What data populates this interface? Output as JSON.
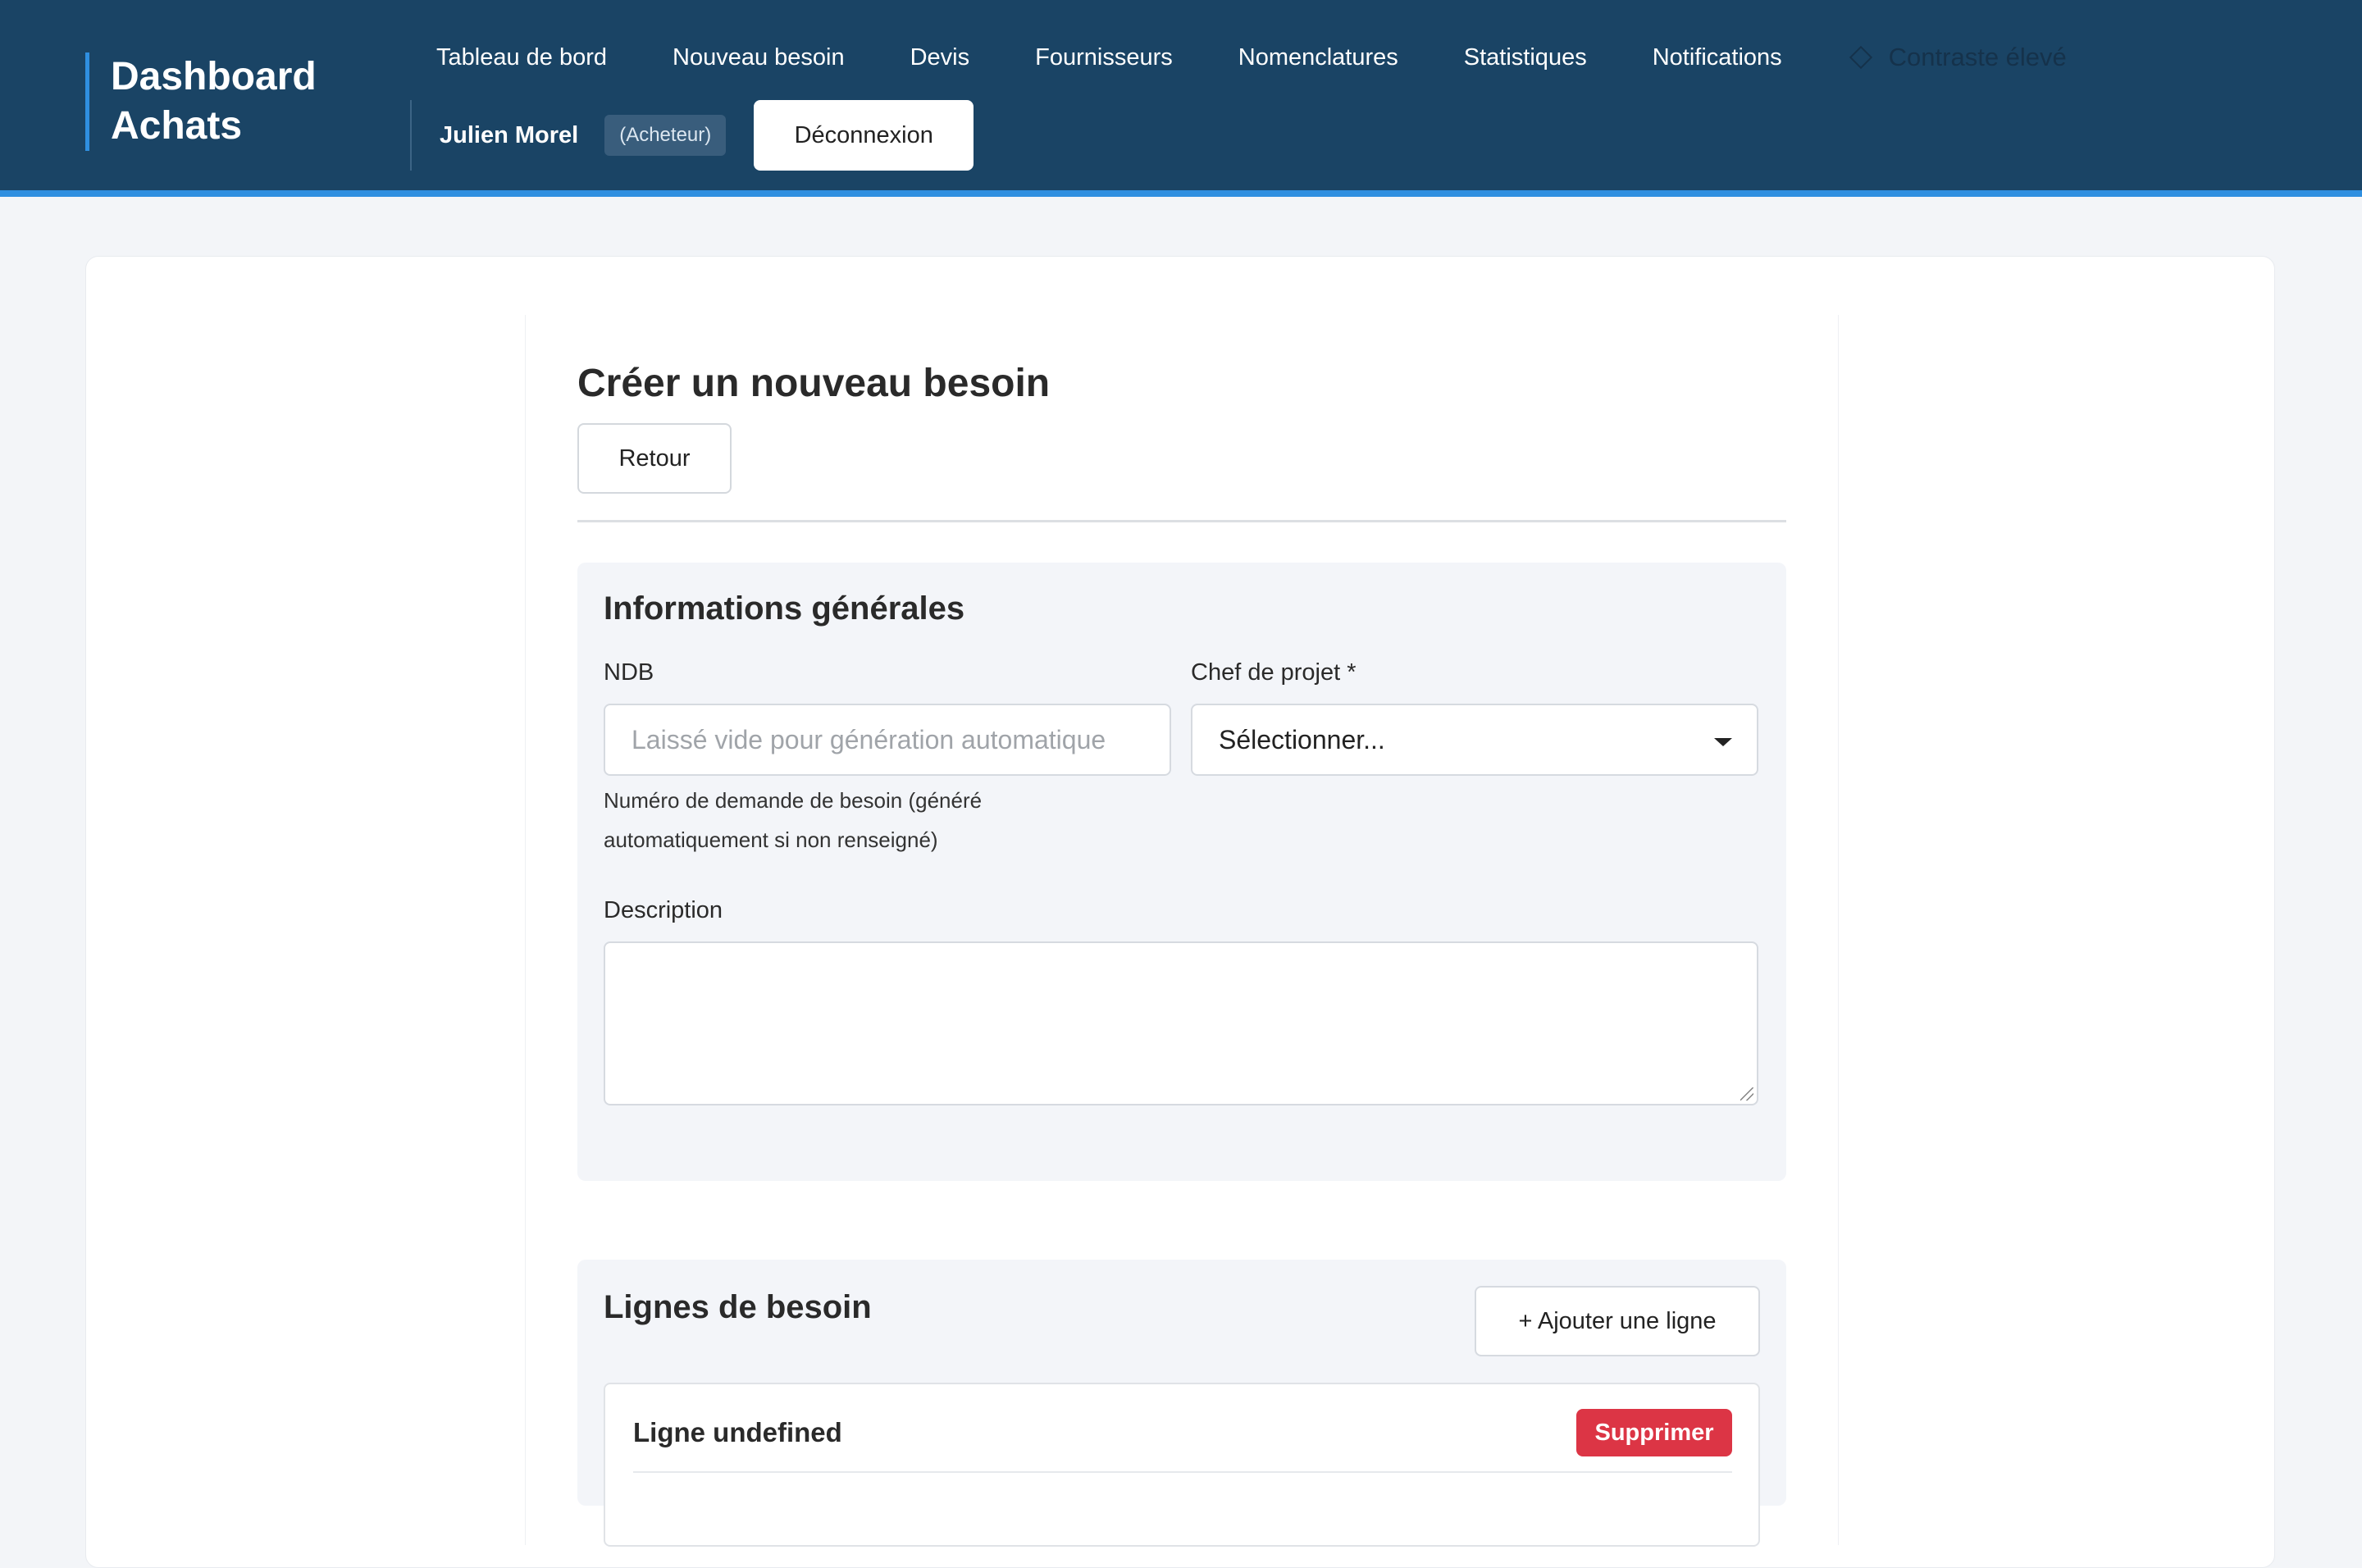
{
  "header": {
    "brand": "Dashboard Achats",
    "nav": [
      {
        "label": "Tableau de bord"
      },
      {
        "label": "Nouveau besoin"
      },
      {
        "label": "Devis"
      },
      {
        "label": "Fournisseurs"
      },
      {
        "label": "Nomenclatures"
      },
      {
        "label": "Statistiques"
      },
      {
        "label": "Notifications"
      }
    ],
    "contrast_label": "Contraste élevé",
    "user_name": "Julien Morel",
    "user_role": "(Acheteur)",
    "logout_label": "Déconnexion"
  },
  "page": {
    "title": "Créer un nouveau besoin",
    "back_label": "Retour"
  },
  "general": {
    "title": "Informations générales",
    "ndb_label": "NDB",
    "ndb_placeholder": "Laissé vide pour génération automatique",
    "ndb_value": "",
    "ndb_help": "Numéro de demande de besoin (généré automatiquement si non renseigné)",
    "chef_label": "Chef de projet *",
    "chef_selected": "Sélectionner...",
    "description_label": "Description",
    "description_value": ""
  },
  "lines": {
    "title": "Lignes de besoin",
    "add_label": "+ Ajouter une ligne",
    "items": [
      {
        "title": "Ligne undefined",
        "delete_label": "Supprimer"
      }
    ]
  },
  "colors": {
    "header_bg": "#1a4465",
    "accent": "#2f8fe0",
    "danger": "#dc3545"
  }
}
